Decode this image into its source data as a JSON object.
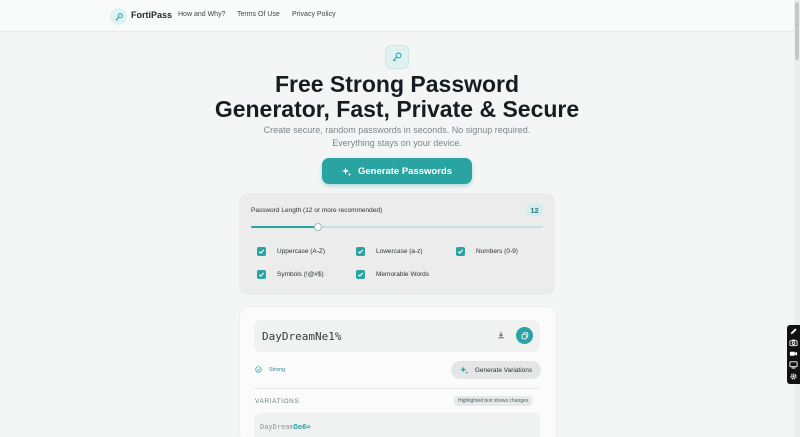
{
  "header": {
    "brand": "FortiPass",
    "nav": [
      "How and Why?",
      "Terms Of Use",
      "Privacy Policy"
    ]
  },
  "hero": {
    "title_line1": "Free Strong Password",
    "title_line2": "Generator, Fast, Private & Secure",
    "subtitle_line1": "Create secure, random passwords in seconds. No signup required.",
    "subtitle_line2": "Everything stays on your device.",
    "generate_label": "Generate Passwords"
  },
  "settings": {
    "length_label": "Password Length (12 or more recommended)",
    "length_value": "12",
    "slider_fraction": 0.23,
    "options": [
      {
        "label": "Uppercase (A-Z)",
        "checked": true
      },
      {
        "label": "Lowercase (a-z)",
        "checked": true
      },
      {
        "label": "Numbers (0-9)",
        "checked": true
      },
      {
        "label": "Symbols (!@#$)",
        "checked": true
      },
      {
        "label": "Memorable Words",
        "checked": true
      }
    ]
  },
  "result": {
    "password": "DayDreamNe1%",
    "strength": "Strong",
    "variations_button": "Generate Variations",
    "variations_title": "VARIATIONS",
    "variations_hint": "Highlighted text shows changes",
    "variation_base": "DayDream",
    "variation_changed": "De6="
  },
  "colors": {
    "accent": "#2aa3a3",
    "accent_light": "#dff1f1",
    "background": "#f4f6f6"
  }
}
